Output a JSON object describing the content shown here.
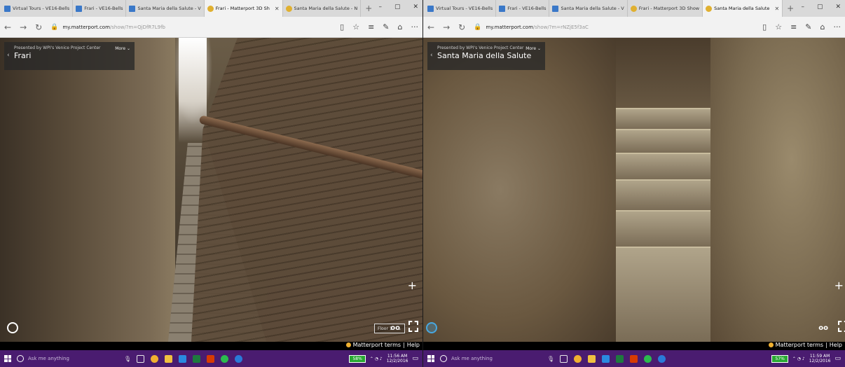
{
  "left": {
    "tabs": [
      {
        "title": "Virtual Tours - VE16-Bells",
        "icon": "matterport-icon",
        "active": false
      },
      {
        "title": "Frari - VE16-Bells",
        "icon": "matterport-icon",
        "active": false
      },
      {
        "title": "Santa Maria della Salute - V",
        "icon": "matterport-icon",
        "active": false
      },
      {
        "title": "Frari - Matterport 3D Sh",
        "icon": "matterport-logo-icon",
        "active": true
      },
      {
        "title": "Santa Maria della Salute - N",
        "icon": "matterport-logo-icon",
        "active": false
      }
    ],
    "url_domain": "my.matterport.com",
    "url_path": "/show/?m=QjDfR7L9fb",
    "presented_by": "Presented by WPI's Venice Project Center",
    "title": "Frari",
    "more_label": "More",
    "floor_label": "Floor 1",
    "terms_label": "Matterport terms",
    "help_label": "Help",
    "clock_time": "11:56 AM",
    "clock_date": "12/2/2016",
    "battery": "58%"
  },
  "right": {
    "tabs": [
      {
        "title": "Virtual Tours - VE16-Bells",
        "icon": "matterport-icon",
        "active": false
      },
      {
        "title": "Frari - VE16-Bells",
        "icon": "matterport-icon",
        "active": false
      },
      {
        "title": "Santa Maria della Salute - V",
        "icon": "matterport-icon",
        "active": false
      },
      {
        "title": "Frari - Matterport 3D Show",
        "icon": "matterport-logo-icon",
        "active": false
      },
      {
        "title": "Santa Maria della Salute",
        "icon": "matterport-logo-icon",
        "active": true
      }
    ],
    "url_domain": "my.matterport.com",
    "url_path": "/show/?m=rNZjE5f3aC",
    "presented_by": "Presented by WPI's Venice Project Center",
    "title": "Santa Maria della Salute",
    "more_label": "More",
    "terms_label": "Matterport terms",
    "help_label": "Help",
    "clock_time": "11:59 AM",
    "clock_date": "12/2/2016",
    "battery": "57%"
  },
  "taskbar": {
    "search_placeholder": "Ask me anything",
    "app_colors": [
      "#e8e8e8",
      "#f0b030",
      "#3a78c8",
      "#2a8ae0",
      "#1e7a3e",
      "#d83b01",
      "#2bbb4e",
      "#2a7ad8"
    ]
  }
}
